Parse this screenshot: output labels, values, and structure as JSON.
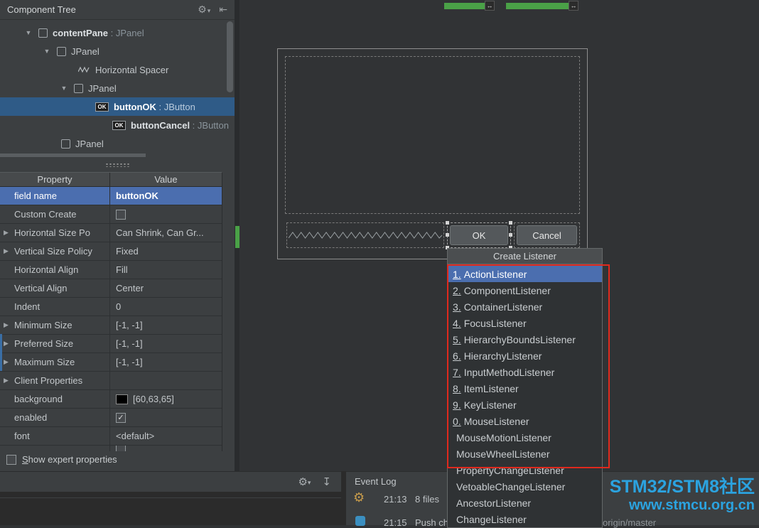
{
  "colors": {
    "accent-blue": "#4b6eaf",
    "tree-selection": "#2f5b87",
    "panel-bg": "#3c3f41",
    "canvas-bg": "#313335",
    "console-bg": "#2b2b2b",
    "annotation-red": "#e0291d",
    "annotation-green": "#4aa147",
    "watermark-blue": "#2ba3e0",
    "swatch-black": "#000000"
  },
  "icons": {
    "expanded": "▼",
    "collapsed": "▶",
    "gear": "⚙",
    "dropdown": "▾",
    "collapse_all": "⇤",
    "download": "↧",
    "resize_handle": "↔",
    "check": "✓",
    "ok_badge": "OK"
  },
  "tree": {
    "title": "Component Tree",
    "items": [
      {
        "label": "contentPane",
        "suffix": " : JPanel"
      },
      {
        "label": "JPanel",
        "suffix": ""
      },
      {
        "label": "Horizontal Spacer",
        "suffix": ""
      },
      {
        "label": "JPanel",
        "suffix": ""
      },
      {
        "label": "buttonOK",
        "suffix": " : JButton"
      },
      {
        "label": "buttonCancel",
        "suffix": " : JButton"
      },
      {
        "label": "JPanel",
        "suffix": ""
      }
    ]
  },
  "properties": {
    "col_property": "Property",
    "col_value": "Value",
    "rows": [
      {
        "name": "field name",
        "value": "buttonOK"
      },
      {
        "name": "Custom Create",
        "value": ""
      },
      {
        "name": "Horizontal Size Po",
        "value": "Can Shrink, Can Gr..."
      },
      {
        "name": "Vertical Size Policy",
        "value": "Fixed"
      },
      {
        "name": "Horizontal Align",
        "value": "Fill"
      },
      {
        "name": "Vertical Align",
        "value": "Center"
      },
      {
        "name": "Indent",
        "value": "0"
      },
      {
        "name": "Minimum Size",
        "value": "[-1, -1]"
      },
      {
        "name": "Preferred Size",
        "value": "[-1, -1]"
      },
      {
        "name": "Maximum Size",
        "value": "[-1, -1]"
      },
      {
        "name": "Client Properties",
        "value": ""
      },
      {
        "name": "background",
        "value": "[60,63,65]"
      },
      {
        "name": "enabled",
        "value": ""
      },
      {
        "name": "font",
        "value": "<default>"
      }
    ],
    "expert_label": "Show expert properties"
  },
  "designer": {
    "ok_label": "OK",
    "cancel_label": "Cancel"
  },
  "popup": {
    "title": "Create Listener",
    "items": [
      {
        "num": "1.",
        "name": "ActionListener"
      },
      {
        "num": "2.",
        "name": "ComponentListener"
      },
      {
        "num": "3.",
        "name": "ContainerListener"
      },
      {
        "num": "4.",
        "name": "FocusListener"
      },
      {
        "num": "5.",
        "name": "HierarchyBoundsListener"
      },
      {
        "num": "6.",
        "name": "HierarchyListener"
      },
      {
        "num": "7.",
        "name": "InputMethodListener"
      },
      {
        "num": "8.",
        "name": "ItemListener"
      },
      {
        "num": "9.",
        "name": "KeyListener"
      },
      {
        "num": "0.",
        "name": "MouseListener"
      },
      {
        "num": "",
        "name": "MouseMotionListener"
      },
      {
        "num": "",
        "name": "MouseWheelListener"
      },
      {
        "num": "",
        "name": "PropertyChangeListener"
      },
      {
        "num": "",
        "name": "VetoableChangeListener"
      },
      {
        "num": "",
        "name": "AncestorListener"
      },
      {
        "num": "",
        "name": "ChangeListener"
      }
    ]
  },
  "event_log": {
    "title": "Event Log",
    "entries": [
      {
        "time": "21:13",
        "text": "8 files"
      },
      {
        "time": "21:15",
        "text": "Push ch"
      }
    ],
    "branch": "origin/master"
  },
  "watermark": {
    "line1": "STM32/STM8社区",
    "line2": "www.stmcu.org.cn"
  }
}
